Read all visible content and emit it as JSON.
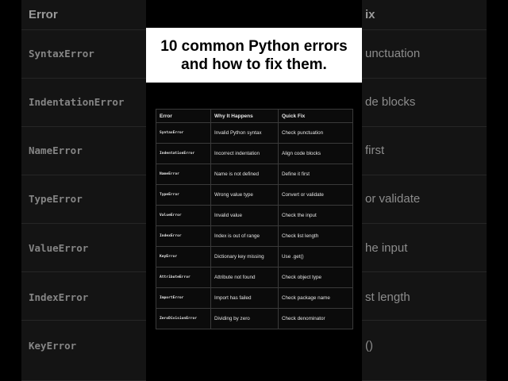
{
  "title": "10 common Python errors and how to fix them.",
  "table": {
    "headers": [
      "Error",
      "Why It Happens",
      "Quick Fix"
    ],
    "rows": [
      [
        "SyntaxError",
        "Invalid Python syntax",
        "Check punctuation"
      ],
      [
        "IndentationError",
        "Incorrect indentation",
        "Align code blocks"
      ],
      [
        "NameError",
        "Name is not defined",
        "Define it first"
      ],
      [
        "TypeError",
        "Wrong value type",
        "Convert or validate"
      ],
      [
        "ValueError",
        "Invalid value",
        "Check the input"
      ],
      [
        "IndexError",
        "Index is out of range",
        "Check list length"
      ],
      [
        "KeyError",
        "Dictionary key missing",
        "Use .get()"
      ],
      [
        "AttributeError",
        "Attribute not found",
        "Check object type"
      ],
      [
        "ImportError",
        "Import has failed",
        "Check package name"
      ],
      [
        "ZeroDivisionError",
        "Dividing by zero",
        "Check denominator"
      ]
    ]
  },
  "background": {
    "header_left": "Error",
    "header_right": "ix",
    "rows": [
      {
        "error": "SyntaxError",
        "fix": "unctuation"
      },
      {
        "error": "IndentationError",
        "fix": "de blocks"
      },
      {
        "error": "NameError",
        "fix": "first"
      },
      {
        "error": "TypeError",
        "fix": "or validate"
      },
      {
        "error": "ValueError",
        "fix": "he input"
      },
      {
        "error": "IndexError",
        "fix": "st length"
      },
      {
        "error": "KeyError",
        "fix": "()"
      }
    ]
  },
  "colors": {
    "background": "#000000",
    "blur_panel": "#141414",
    "title_card": "#ffffff",
    "table_text": "#e6e6e6"
  }
}
